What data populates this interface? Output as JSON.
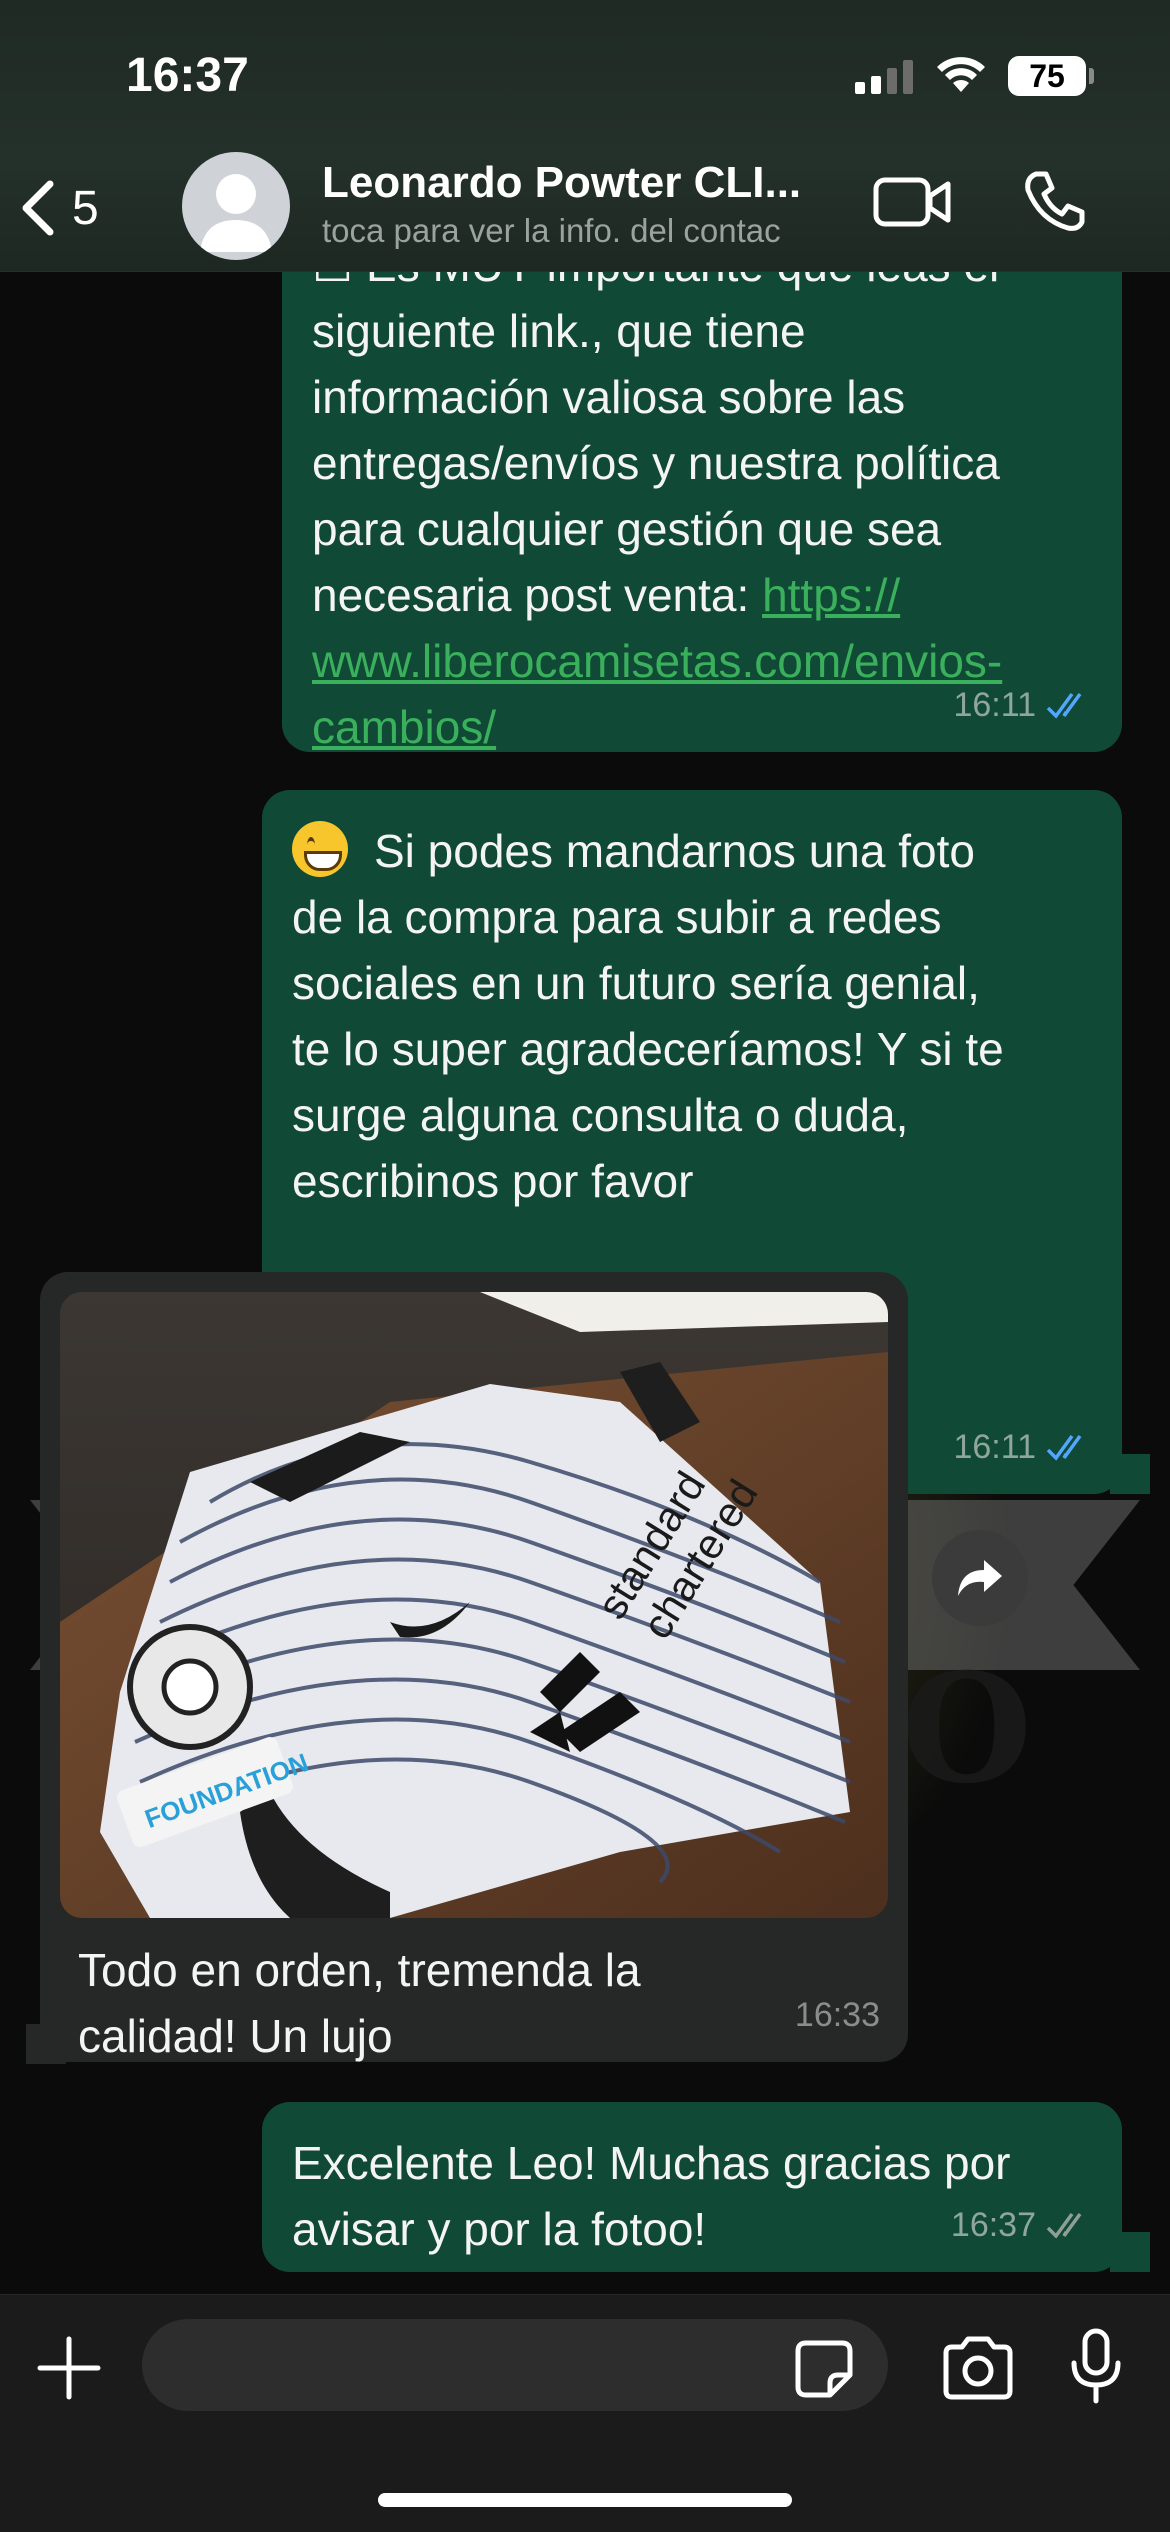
{
  "status_bar": {
    "time": "16:37",
    "battery": "75"
  },
  "header": {
    "back_count": "5",
    "contact_name": "Leonardo Powter CLI...",
    "contact_subtitle": "toca para ver la info. del contac",
    "icons": [
      "back-chevron-icon",
      "avatar",
      "video-call-icon",
      "phone-icon"
    ]
  },
  "messages": [
    {
      "id": "m1",
      "direction": "outgoing",
      "text_partial_top": "☐ Es MUY importante que leas el",
      "text": "siguiente link., que tiene\ninformación valiosa sobre las\nentregas/envíos y nuestra política\npara cualquier gestión que sea\nnecesaria post venta: ",
      "link_text": "https://\nwww.liberocamisetas.com/envios-\ncambios/",
      "time": "16:11",
      "status": "read"
    },
    {
      "id": "m2",
      "direction": "outgoing",
      "emoji": "grinning-face",
      "text": "Si podes mandarnos una foto\nde la compra para subir a redes\nsociales en un futuro sería genial,\nte lo super agradeceríamos! Y si te\nsurge alguna consulta o duda,\nescribinos por favor",
      "time": "16:11",
      "status": "read"
    },
    {
      "id": "m3",
      "direction": "incoming",
      "has_photo": true,
      "photo_text": {
        "sponsor_line1": "standard",
        "sponsor_line2": "chartered",
        "patch": "FOUNDATION"
      },
      "text": "Todo en orden, tremenda la\ncalidad! Un lujo",
      "time": "16:33"
    },
    {
      "id": "m4",
      "direction": "outgoing",
      "text": "Excelente Leo! Muchas gracias por\navisar y por la fotoo!",
      "time": "16:37",
      "status": "delivered"
    }
  ],
  "input_bar": {
    "placeholder": ""
  },
  "colors": {
    "outgoing_bubble": "#104a36",
    "incoming_bubble": "#262827",
    "link": "#3bb05c",
    "read_ticks": "#53a6fd",
    "delivered_ticks": "#8f9f98"
  }
}
